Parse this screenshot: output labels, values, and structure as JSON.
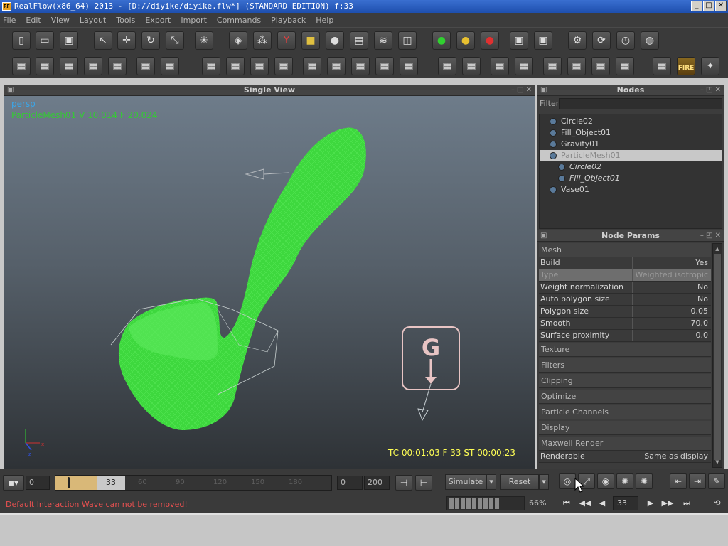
{
  "window": {
    "title": "RealFlow(x86_64) 2013 - [D://diyike/diyike.flw*] (STANDARD EDITION) f:33",
    "app_icon": "RF",
    "minimize_glyph": "_",
    "maximize_glyph": "□",
    "close_glyph": "✕"
  },
  "menu": [
    "File",
    "Edit",
    "View",
    "Layout",
    "Tools",
    "Export",
    "Import",
    "Commands",
    "Playback",
    "Help"
  ],
  "toolbar1": [
    "new-scene-icon",
    "open-folder-icon",
    "save-icon",
    "select-arrow-icon",
    "move-icon",
    "rotate-icon",
    "scale-icon",
    "axis-icon",
    "emitter-icon",
    "particles-icon",
    "daemon-icon",
    "object-icon",
    "sphere-icon",
    "camera-icon",
    "wave-icon",
    "mesh-cube-icon",
    "green-dot-icon",
    "yellow-dot-icon",
    "red-dot-icon",
    "save-green-icon",
    "save-red-icon",
    "sim-icon-1",
    "sim-icon-2",
    "sim-icon-3",
    "sim-icon-4"
  ],
  "toolbar2": [
    "list-icon",
    "cut-icon",
    "box-icon",
    "split-icon",
    "graph-icon",
    "cube-open-icon",
    "cube-cut-icon",
    "script-icon",
    "bars-icon",
    "ruler-icon",
    "gear-dots-icon",
    "frame-1-icon",
    "frame-2-icon",
    "frame-3-icon",
    "frame-4-icon",
    "hourglass-icon",
    "cube-a-icon",
    "cube-b-icon",
    "cube-c-icon",
    "cube-d-icon",
    "cube-e-icon",
    "cube-f-icon",
    "cube-g-icon",
    "cube-h-icon",
    "camera-render-icon",
    "fire-icon",
    "mystic-icon"
  ],
  "fire_label": "FIRE",
  "viewport": {
    "title": "Single View",
    "camera": "persp",
    "mesh_info": "ParticleMesh01  V 10.014  F 20.024",
    "gravity_glyph": "G",
    "timecode": "TC 00:01:03    F 33    ST 00:00:23",
    "axis_x": "x",
    "axis_z": "z"
  },
  "nodes": {
    "title": "Nodes",
    "filter_label": "Filter",
    "filter_value": "",
    "items": [
      {
        "label": "Circle02",
        "selected": false,
        "child": false
      },
      {
        "label": "Fill_Object01",
        "selected": false,
        "child": false
      },
      {
        "label": "Gravity01",
        "selected": false,
        "child": false
      },
      {
        "label": "ParticleMesh01",
        "selected": true,
        "child": false
      },
      {
        "label": "Circle02",
        "selected": false,
        "child": true
      },
      {
        "label": "Fill_Object01",
        "selected": false,
        "child": true
      },
      {
        "label": "Vase01",
        "selected": false,
        "child": false
      }
    ]
  },
  "params": {
    "title": "Node Params",
    "section_mesh": "Mesh",
    "rows": [
      {
        "key": "Build",
        "value": "Yes",
        "highlight": false
      },
      {
        "key": "Type",
        "value": "Weighted isotropic",
        "highlight": true
      },
      {
        "key": "Weight normalization",
        "value": "No",
        "highlight": false
      },
      {
        "key": "Auto polygon size",
        "value": "No",
        "highlight": false
      },
      {
        "key": "Polygon size",
        "value": "0.05",
        "highlight": false
      },
      {
        "key": "Smooth",
        "value": "70.0",
        "highlight": false
      },
      {
        "key": "Surface proximity",
        "value": "0.0",
        "highlight": false
      }
    ],
    "sections": [
      "Texture",
      "Filters",
      "Clipping",
      "Optimize",
      "Particle Channels",
      "Display",
      "Maxwell Render"
    ],
    "renderable_key": "Renderable",
    "renderable_value": "Same as display"
  },
  "timeline": {
    "start": "0",
    "current": "33",
    "ticks": [
      "60",
      "90",
      "120",
      "150",
      "180"
    ],
    "range_start": "0",
    "range_end": "200",
    "played_fraction": 0.155,
    "simulate": "Simulate",
    "reset": "Reset",
    "status": "Default Interaction Wave can not be removed!",
    "progress_percent": "66%",
    "frame": "33"
  }
}
